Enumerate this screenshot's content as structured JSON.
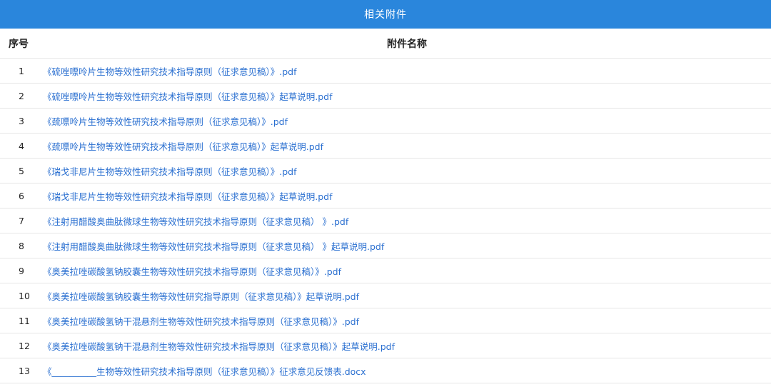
{
  "banner": {
    "title": "相关附件"
  },
  "table": {
    "headers": {
      "no": "序号",
      "name": "附件名称"
    },
    "rows": [
      {
        "no": "1",
        "name": "《硫唑嘌呤片生物等效性研究技术指导原则（征求意见稿）》.pdf"
      },
      {
        "no": "2",
        "name": "《硫唑嘌呤片生物等效性研究技术指导原则（征求意见稿）》起草说明.pdf"
      },
      {
        "no": "3",
        "name": "《巯嘌呤片生物等效性研究技术指导原则（征求意见稿）》.pdf"
      },
      {
        "no": "4",
        "name": "《巯嘌呤片生物等效性研究技术指导原则（征求意见稿）》起草说明.pdf"
      },
      {
        "no": "5",
        "name": "《瑞戈非尼片生物等效性研究技术指导原则（征求意见稿）》.pdf"
      },
      {
        "no": "6",
        "name": "《瑞戈非尼片生物等效性研究技术指导原则（征求意见稿）》起草说明.pdf"
      },
      {
        "no": "7",
        "name": "《注射用醋酸奥曲肽微球生物等效性研究技术指导原则（征求意见稿） 》.pdf"
      },
      {
        "no": "8",
        "name": "《注射用醋酸奥曲肽微球生物等效性研究技术指导原则（征求意见稿） 》起草说明.pdf"
      },
      {
        "no": "9",
        "name": "《奥美拉唑碳酸氢钠胶囊生物等效性研究技术指导原则（征求意见稿）》.pdf"
      },
      {
        "no": "10",
        "name": "《奥美拉唑碳酸氢钠胶囊生物等效性研究指导原则（征求意见稿）》起草说明.pdf"
      },
      {
        "no": "11",
        "name": "《奥美拉唑碳酸氢钠干混悬剂生物等效性研究技术指导原则（征求意见稿）》.pdf"
      },
      {
        "no": "12",
        "name": "《奥美拉唑碳酸氢钠干混悬剂生物等效性研究技术指导原则（征求意见稿）》起草说明.pdf"
      },
      {
        "no": "13",
        "name": "《__________生物等效性研究技术指导原则（征求意见稿）》征求意见反馈表.docx"
      }
    ]
  }
}
